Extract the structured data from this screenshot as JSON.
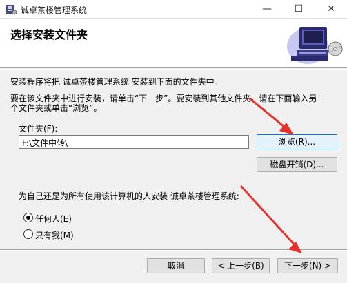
{
  "window": {
    "title": "诚卓茶楼管理系统",
    "minimize_glyph": "—",
    "maximize_glyph": "☐",
    "close_glyph": "✕"
  },
  "header": {
    "title": "选择安装文件夹"
  },
  "body": {
    "intro": "安装程序将把 诚卓茶楼管理系统 安装到下面的文件夹中。",
    "instruction_line1": "要在该文件夹中进行安装，请单击“下一步”。要安装到其他文件夹，请在下面输入另一",
    "instruction_line2": "个文件夹或单击“浏览”。",
    "folder_label": "文件夹(F):",
    "folder_value": "F:\\文件中转\\",
    "browse_label": "浏览(R)...",
    "disk_cost_label": "磁盘开销(D)...",
    "install_for_label": "为自己还是为所有使用该计算机的人安装 诚卓茶楼管理系统:",
    "radio_everyone": "任何人(E)",
    "radio_just_me": "只有我(M)",
    "selected_option": "everyone"
  },
  "footer": {
    "cancel_label": "取消",
    "back_label": "< 上一步(B)",
    "next_label": "下一步(N) >"
  },
  "colors": {
    "annotation_arrow": "#e8312a",
    "focus_border": "#0078d7"
  }
}
